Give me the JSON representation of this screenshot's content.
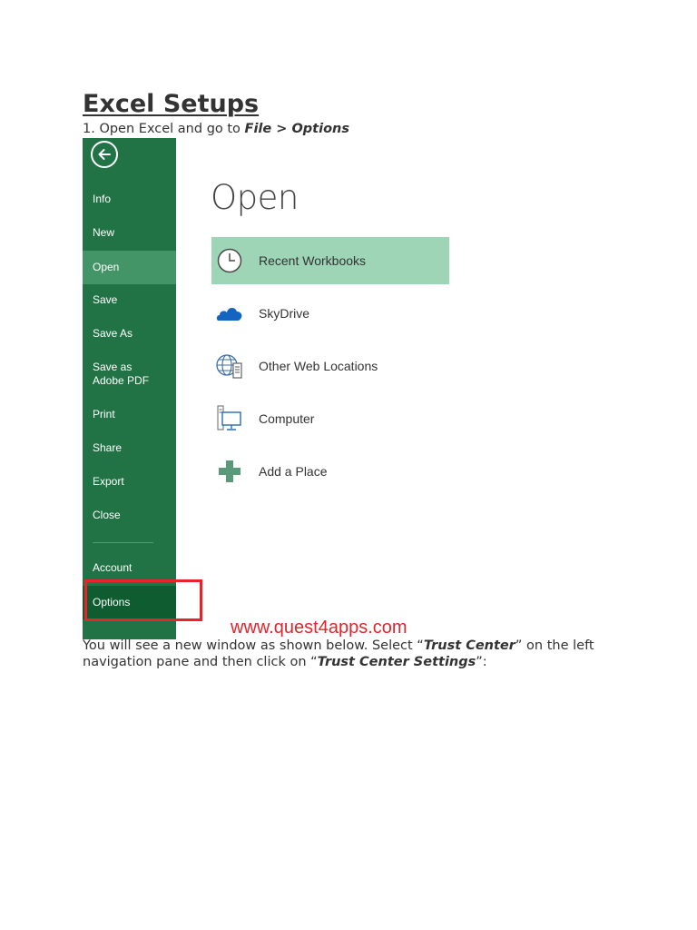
{
  "document": {
    "title": "Excel Setups",
    "step1": {
      "prefix": "1. Open Excel and go to ",
      "emphasis": "File > Options"
    },
    "paragraph": {
      "part1": "You will see a new window as shown below. Select “",
      "emphasis1": "Trust Center",
      "part2": "” on the left navigation pane and then click on “",
      "emphasis2": "Trust Center Settings",
      "part3": "”:"
    }
  },
  "screenshot": {
    "backstage": {
      "nav_items": [
        "Info",
        "New",
        "Open",
        "Save",
        "Save As",
        "Save as Adobe PDF",
        "Print",
        "Share",
        "Export",
        "Close",
        "Account",
        "Options"
      ],
      "active_item": "Open",
      "selected_item": "Options"
    },
    "open_pane": {
      "heading": "Open",
      "places": [
        {
          "label": "Recent Workbooks",
          "icon": "clock-icon"
        },
        {
          "label": "SkyDrive",
          "icon": "cloud-icon"
        },
        {
          "label": "Other Web Locations",
          "icon": "globe-icon"
        },
        {
          "label": "Computer",
          "icon": "computer-icon"
        },
        {
          "label": "Add a Place",
          "icon": "plus-icon"
        }
      ]
    },
    "watermark": "www.quest4apps.com"
  },
  "colors": {
    "excel_green": "#217346",
    "active_green": "#439467",
    "selected_green": "#0e5c2f",
    "highlight_row": "#9fd5b7",
    "callout_red": "#e8242b"
  }
}
